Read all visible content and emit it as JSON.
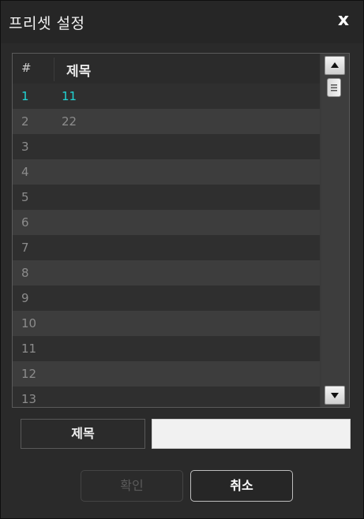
{
  "dialog": {
    "title": "프리셋 설정",
    "close_label": "x"
  },
  "list": {
    "header_number": "#",
    "header_title": "제목",
    "rows": [
      {
        "number": "1",
        "title": "11",
        "selected": true
      },
      {
        "number": "2",
        "title": "22",
        "selected": false
      },
      {
        "number": "3",
        "title": "",
        "selected": false
      },
      {
        "number": "4",
        "title": "",
        "selected": false
      },
      {
        "number": "5",
        "title": "",
        "selected": false
      },
      {
        "number": "6",
        "title": "",
        "selected": false
      },
      {
        "number": "7",
        "title": "",
        "selected": false
      },
      {
        "number": "8",
        "title": "",
        "selected": false
      },
      {
        "number": "9",
        "title": "",
        "selected": false
      },
      {
        "number": "10",
        "title": "",
        "selected": false
      },
      {
        "number": "11",
        "title": "",
        "selected": false
      },
      {
        "number": "12",
        "title": "",
        "selected": false
      },
      {
        "number": "13",
        "title": "",
        "selected": false
      }
    ]
  },
  "form": {
    "title_label": "제목",
    "title_value": ""
  },
  "buttons": {
    "ok_label": "확인",
    "cancel_label": "취소"
  },
  "colors": {
    "selected_text": "#21d4d4",
    "row_dark": "#2f2f2f",
    "row_light": "#3d3d3d"
  }
}
